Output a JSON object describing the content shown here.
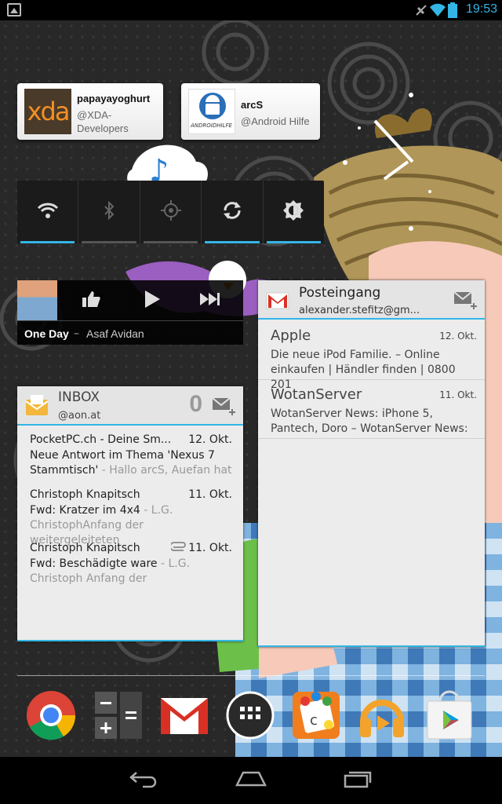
{
  "status_bar": {
    "time": "19:53"
  },
  "twitter_widgets": [
    {
      "name": "papayayoghurt",
      "handle_line1": "@XDA-",
      "handle_line2": "Developers",
      "thumb_text": "xda"
    },
    {
      "name": "arcS",
      "handle_line1": "@Android Hilfe",
      "handle_line2": "",
      "thumb_text": "ANDROIDHILFE"
    }
  ],
  "power_control": {
    "toggles": [
      {
        "icon": "wifi-icon",
        "on": true
      },
      {
        "icon": "bluetooth-icon",
        "on": false
      },
      {
        "icon": "gps-icon",
        "on": false
      },
      {
        "icon": "sync-icon",
        "on": true
      },
      {
        "icon": "brightness-icon",
        "on": true
      }
    ]
  },
  "music": {
    "title": "One Day",
    "separator": "–",
    "artist": "Asaf Avidan"
  },
  "gmail": {
    "label": "Posteingang",
    "account": "alexander.stefitz@gm...",
    "messages": [
      {
        "from": "Apple",
        "date": "12. Okt.",
        "snippet": "Die neue iPod Familie. – Online einkaufen | Händler finden | 0800 201"
      },
      {
        "from": "WotanServer",
        "date": "11. Okt.",
        "snippet": "WotanServer News: iPhone 5, Pantech, Doro – WotanServer News:"
      }
    ]
  },
  "email": {
    "label": "INBOX",
    "account": "@aon.at",
    "unread_count": "0",
    "messages": [
      {
        "from": "PocketPC.ch - Deine Sm...",
        "date": "12. Okt.",
        "subject": "Neue Antwort im Thema 'Nexus 7 Stammtisch'",
        "preview": "Hallo arcS, Auefan hat",
        "attachment": false
      },
      {
        "from": "Christoph Knapitsch",
        "date": "11. Okt.",
        "subject": "Fwd: Kratzer im 4x4",
        "preview": "L.G. ChristophAnfang der weitergeleiteten",
        "attachment": false
      },
      {
        "from": "Christoph Knapitsch",
        "date": "11. Okt.",
        "subject": "Fwd: Beschädigte ware",
        "preview": "L.G. Christoph Anfang der",
        "attachment": true
      }
    ]
  },
  "dock": {
    "apps": [
      {
        "name": "Chrome",
        "icon": "chrome-icon"
      },
      {
        "name": "Calculator",
        "icon": "calculator-icon"
      },
      {
        "name": "Gmail",
        "icon": "gmail-icon"
      },
      {
        "name": "All Apps",
        "icon": "app-drawer-icon"
      },
      {
        "name": "Board game",
        "icon": "game-icon"
      },
      {
        "name": "Play Music",
        "icon": "headphones-icon"
      },
      {
        "name": "Play Store",
        "icon": "play-store-icon"
      }
    ]
  },
  "nav_bar": {
    "buttons": [
      "back",
      "home",
      "recents"
    ]
  },
  "colors": {
    "accent": "#33b5e5",
    "status_bg": "#000000",
    "widget_bg": "#ececec"
  }
}
